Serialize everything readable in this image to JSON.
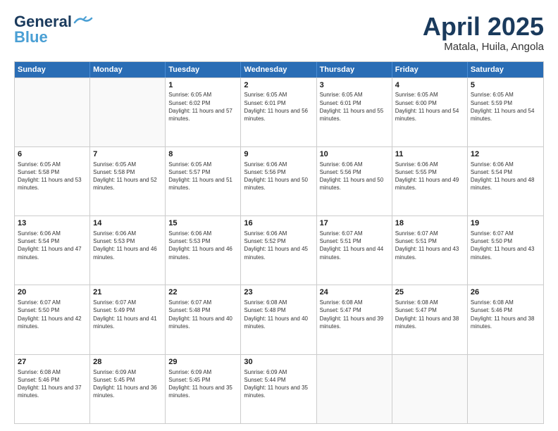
{
  "header": {
    "logo_line1": "General",
    "logo_line2": "Blue",
    "month": "April 2025",
    "location": "Matala, Huila, Angola"
  },
  "days_of_week": [
    "Sunday",
    "Monday",
    "Tuesday",
    "Wednesday",
    "Thursday",
    "Friday",
    "Saturday"
  ],
  "weeks": [
    [
      {
        "day": "",
        "info": ""
      },
      {
        "day": "",
        "info": ""
      },
      {
        "day": "1",
        "info": "Sunrise: 6:05 AM\nSunset: 6:02 PM\nDaylight: 11 hours and 57 minutes."
      },
      {
        "day": "2",
        "info": "Sunrise: 6:05 AM\nSunset: 6:01 PM\nDaylight: 11 hours and 56 minutes."
      },
      {
        "day": "3",
        "info": "Sunrise: 6:05 AM\nSunset: 6:01 PM\nDaylight: 11 hours and 55 minutes."
      },
      {
        "day": "4",
        "info": "Sunrise: 6:05 AM\nSunset: 6:00 PM\nDaylight: 11 hours and 54 minutes."
      },
      {
        "day": "5",
        "info": "Sunrise: 6:05 AM\nSunset: 5:59 PM\nDaylight: 11 hours and 54 minutes."
      }
    ],
    [
      {
        "day": "6",
        "info": "Sunrise: 6:05 AM\nSunset: 5:58 PM\nDaylight: 11 hours and 53 minutes."
      },
      {
        "day": "7",
        "info": "Sunrise: 6:05 AM\nSunset: 5:58 PM\nDaylight: 11 hours and 52 minutes."
      },
      {
        "day": "8",
        "info": "Sunrise: 6:05 AM\nSunset: 5:57 PM\nDaylight: 11 hours and 51 minutes."
      },
      {
        "day": "9",
        "info": "Sunrise: 6:06 AM\nSunset: 5:56 PM\nDaylight: 11 hours and 50 minutes."
      },
      {
        "day": "10",
        "info": "Sunrise: 6:06 AM\nSunset: 5:56 PM\nDaylight: 11 hours and 50 minutes."
      },
      {
        "day": "11",
        "info": "Sunrise: 6:06 AM\nSunset: 5:55 PM\nDaylight: 11 hours and 49 minutes."
      },
      {
        "day": "12",
        "info": "Sunrise: 6:06 AM\nSunset: 5:54 PM\nDaylight: 11 hours and 48 minutes."
      }
    ],
    [
      {
        "day": "13",
        "info": "Sunrise: 6:06 AM\nSunset: 5:54 PM\nDaylight: 11 hours and 47 minutes."
      },
      {
        "day": "14",
        "info": "Sunrise: 6:06 AM\nSunset: 5:53 PM\nDaylight: 11 hours and 46 minutes."
      },
      {
        "day": "15",
        "info": "Sunrise: 6:06 AM\nSunset: 5:53 PM\nDaylight: 11 hours and 46 minutes."
      },
      {
        "day": "16",
        "info": "Sunrise: 6:06 AM\nSunset: 5:52 PM\nDaylight: 11 hours and 45 minutes."
      },
      {
        "day": "17",
        "info": "Sunrise: 6:07 AM\nSunset: 5:51 PM\nDaylight: 11 hours and 44 minutes."
      },
      {
        "day": "18",
        "info": "Sunrise: 6:07 AM\nSunset: 5:51 PM\nDaylight: 11 hours and 43 minutes."
      },
      {
        "day": "19",
        "info": "Sunrise: 6:07 AM\nSunset: 5:50 PM\nDaylight: 11 hours and 43 minutes."
      }
    ],
    [
      {
        "day": "20",
        "info": "Sunrise: 6:07 AM\nSunset: 5:50 PM\nDaylight: 11 hours and 42 minutes."
      },
      {
        "day": "21",
        "info": "Sunrise: 6:07 AM\nSunset: 5:49 PM\nDaylight: 11 hours and 41 minutes."
      },
      {
        "day": "22",
        "info": "Sunrise: 6:07 AM\nSunset: 5:48 PM\nDaylight: 11 hours and 40 minutes."
      },
      {
        "day": "23",
        "info": "Sunrise: 6:08 AM\nSunset: 5:48 PM\nDaylight: 11 hours and 40 minutes."
      },
      {
        "day": "24",
        "info": "Sunrise: 6:08 AM\nSunset: 5:47 PM\nDaylight: 11 hours and 39 minutes."
      },
      {
        "day": "25",
        "info": "Sunrise: 6:08 AM\nSunset: 5:47 PM\nDaylight: 11 hours and 38 minutes."
      },
      {
        "day": "26",
        "info": "Sunrise: 6:08 AM\nSunset: 5:46 PM\nDaylight: 11 hours and 38 minutes."
      }
    ],
    [
      {
        "day": "27",
        "info": "Sunrise: 6:08 AM\nSunset: 5:46 PM\nDaylight: 11 hours and 37 minutes."
      },
      {
        "day": "28",
        "info": "Sunrise: 6:09 AM\nSunset: 5:45 PM\nDaylight: 11 hours and 36 minutes."
      },
      {
        "day": "29",
        "info": "Sunrise: 6:09 AM\nSunset: 5:45 PM\nDaylight: 11 hours and 35 minutes."
      },
      {
        "day": "30",
        "info": "Sunrise: 6:09 AM\nSunset: 5:44 PM\nDaylight: 11 hours and 35 minutes."
      },
      {
        "day": "",
        "info": ""
      },
      {
        "day": "",
        "info": ""
      },
      {
        "day": "",
        "info": ""
      }
    ]
  ]
}
